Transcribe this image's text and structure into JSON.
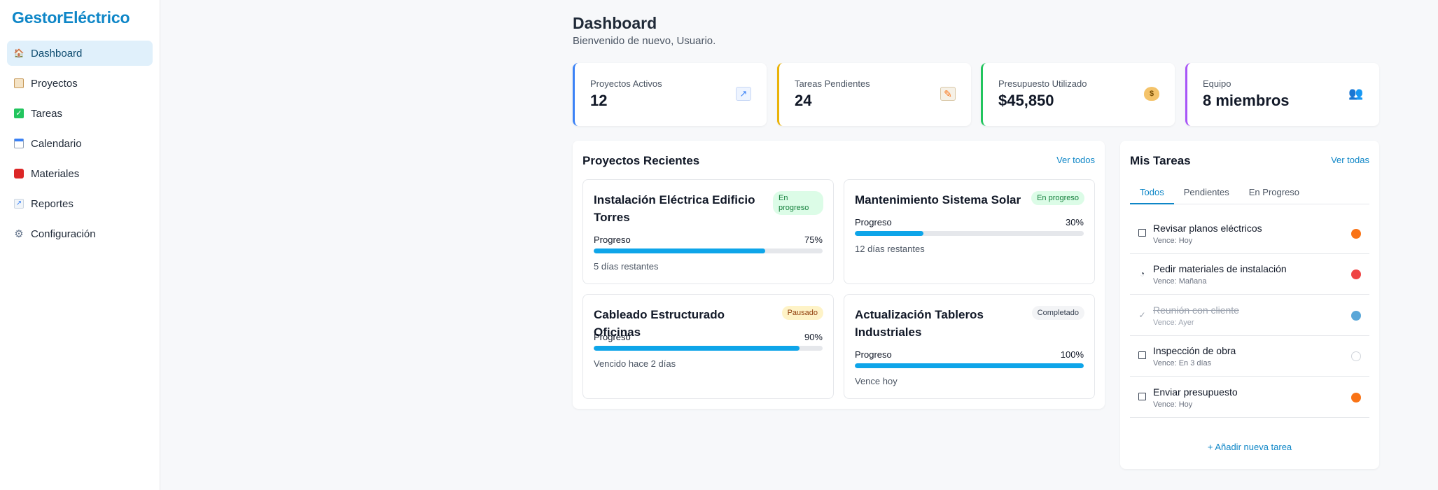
{
  "app": {
    "brand": "GestorEléctrico"
  },
  "sidebar": {
    "items": [
      {
        "label": "Dashboard",
        "icon": "house-icon",
        "active": true
      },
      {
        "label": "Proyectos",
        "icon": "clipboard-icon"
      },
      {
        "label": "Tareas",
        "icon": "checkbox-icon"
      },
      {
        "label": "Calendario",
        "icon": "calendar-icon"
      },
      {
        "label": "Materiales",
        "icon": "toolbox-icon"
      },
      {
        "label": "Reportes",
        "icon": "chart-icon"
      },
      {
        "label": "Configuración",
        "icon": "gear-icon"
      }
    ]
  },
  "header": {
    "title": "Dashboard",
    "subtitle": "Bienvenido de nuevo, Usuario."
  },
  "stats": [
    {
      "label": "Proyectos Activos",
      "value": "12",
      "icon": "chart-increasing-icon",
      "color": "#3b82f6"
    },
    {
      "label": "Tareas Pendientes",
      "value": "24",
      "icon": "memo-icon",
      "color": "#eab308"
    },
    {
      "label": "Presupuesto Utilizado",
      "value": "$45,850",
      "icon": "money-bag-icon",
      "color": "#22c55e"
    },
    {
      "label": "Equipo",
      "value": "8 miembros",
      "icon": "people-icon",
      "color": "#a855f7"
    }
  ],
  "projects": {
    "title": "Proyectos Recientes",
    "link": "Ver todos",
    "progress_label": "Progreso",
    "items": [
      {
        "name": "Instalación Eléctrica Edificio Torres",
        "status": "En progreso",
        "percent_label": "75%",
        "percent": 75,
        "note": "5 días restantes"
      },
      {
        "name": "Mantenimiento Sistema Solar",
        "status": "En progreso",
        "percent_label": "30%",
        "percent": 30,
        "note": "12 días restantes"
      },
      {
        "name": "Cableado Estructurado Oficinas",
        "status": "Pausado",
        "percent_label": "90%",
        "percent": 90,
        "note": "Vencido hace 2 días"
      },
      {
        "name": "Actualización Tableros Industriales",
        "status": "Completado",
        "percent_label": "100%",
        "percent": 100,
        "note": "Vence hoy"
      }
    ]
  },
  "tasks": {
    "title": "Mis Tareas",
    "link": "Ver todas",
    "tabs": [
      "Todos",
      "Pendientes",
      "En Progreso"
    ],
    "items": [
      {
        "title": "Revisar planos eléctricos",
        "due": "Vence: Hoy",
        "state": "pending",
        "priority_color": "#f97316"
      },
      {
        "title": "Pedir materiales de instalación",
        "due": "Vence: Mañana",
        "state": "in-progress",
        "priority_color": "#ef4444"
      },
      {
        "title": "Reunión con cliente",
        "due": "Vence: Ayer",
        "state": "done",
        "priority_color": "#5aa7d8"
      },
      {
        "title": "Inspección de obra",
        "due": "Vence: En 3 días",
        "state": "pending",
        "priority_color": "#ffffff"
      },
      {
        "title": "Enviar presupuesto",
        "due": "Vence: Hoy",
        "state": "pending",
        "priority_color": "#f97316"
      }
    ],
    "add_label": "+ Añadir nueva tarea"
  }
}
